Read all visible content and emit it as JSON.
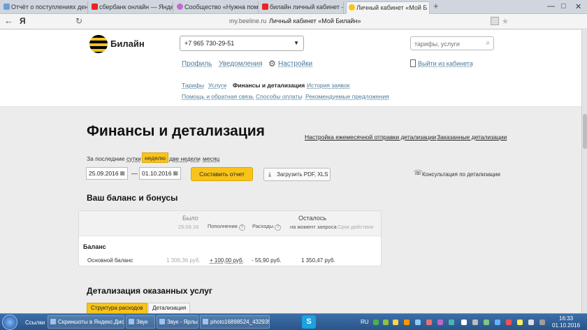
{
  "browser": {
    "tabs": [
      {
        "label": "Отчёт о поступлениях дене",
        "favicon_color": "#6a9fd4"
      },
      {
        "label": "сбербанк онлайн — Яндекс",
        "favicon_color": "#e22"
      },
      {
        "label": "Сообщество «Нужна помо",
        "favicon_color": "#c56ad1"
      },
      {
        "label": "билайн личный кабинет —",
        "favicon_color": "#e22"
      },
      {
        "label": "Личный кабинет «Мой Б",
        "favicon_color": "#f8c41a"
      }
    ],
    "new_tab": "+",
    "win_minimize": "—",
    "win_maximize": "□",
    "win_close": "✕",
    "back": "←",
    "yandex": "Я",
    "refresh": "↻",
    "url_host": "my.beeline.ru",
    "url_title": "Личный кабинет «Мой Билайн»",
    "addr_star": "★"
  },
  "header": {
    "logo_text": "Билайн",
    "phone": "+7 965 730-29-51",
    "select_arrow": "▼",
    "search_placeholder": "тарифы, услуги",
    "search_icon": "⌕",
    "nav": {
      "profile": "Профиль",
      "notifications": "Уведомления",
      "settings_icon": "⚙",
      "settings": "Настройки",
      "logout": "Выйти из кабинета"
    },
    "subnav": {
      "tariffs": "Тарифы",
      "services": "Услуги",
      "finance": "Финансы и детализация",
      "history": "История заявок",
      "help": "Помощь и обратная связь",
      "payment": "Способы оплаты",
      "recommended": "Рекомендуемые предложения"
    }
  },
  "main": {
    "title": "Финансы и детализация",
    "link_monthly": "Настройка ежемесячной отправки детализации",
    "link_ordered": "Заказанные детализации",
    "period_label": "За последние",
    "periods": {
      "day": "сутки",
      "week": "неделю",
      "two_weeks": "две недели",
      "month": "месяц"
    },
    "date_from": "25.09.2016",
    "date_to": "01.10.2016",
    "calendar_icon": "▦",
    "date_dash": "—",
    "report_button": "Составить отчет",
    "download_icon": "⤓",
    "download_button": "Загрузить PDF, XLS",
    "consult_icon": "☏",
    "consult": "Консультация по детализации",
    "balance_title": "Ваш баланс и бонусы",
    "table": {
      "was": "Было",
      "was_date": "25.09.16",
      "income": "Пополнения",
      "expense": "Расходы",
      "left": "Осталось",
      "left_sub": "на момент запроса",
      "validity": "Срок действия",
      "help": "?"
    },
    "section_balance": "Баланс",
    "row": {
      "name": "Основной баланс",
      "was": "1 306,36 руб.",
      "income": "+ 100,00 руб.",
      "expense": "- 55,90 руб.",
      "left": "1 350,47 руб."
    },
    "services_title": "Детализация оказанных услуг",
    "tab_structure": "Структура расходов",
    "tab_detail": "Детализация"
  },
  "taskbar": {
    "links": "Ссылки",
    "items": [
      "Скриншоты в Яндекс.Диске",
      "Звук",
      "Звук - Ярлык",
      "photo16898524_432935275"
    ],
    "skype": "S",
    "lang": "RU",
    "time": "16:33",
    "date": "01.10.2016"
  }
}
